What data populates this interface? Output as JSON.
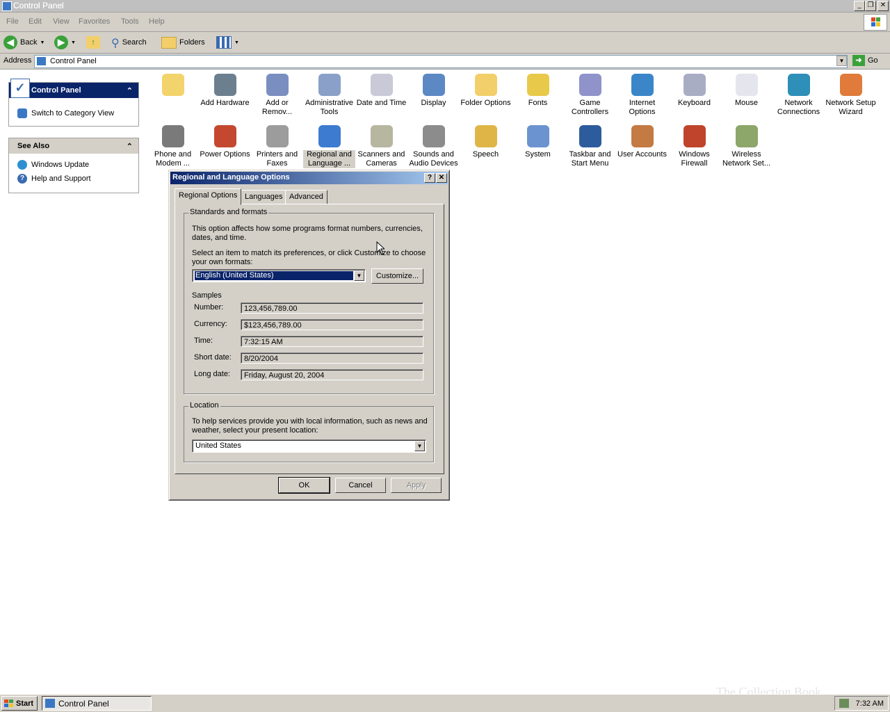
{
  "window": {
    "title": "Control Panel",
    "controls": [
      "_",
      "❐",
      "✕"
    ]
  },
  "menu": [
    "File",
    "Edit",
    "View",
    "Favorites",
    "Tools",
    "Help"
  ],
  "toolbar": {
    "back": "Back",
    "search": "Search",
    "folders": "Folders"
  },
  "address": {
    "label": "Address",
    "value": "Control Panel",
    "go": "Go"
  },
  "sidebar": {
    "control_panel": {
      "title": "Control Panel",
      "items": [
        "Switch to Category View"
      ]
    },
    "see_also": {
      "title": "See Also",
      "items": [
        "Windows Update",
        "Help and Support"
      ]
    }
  },
  "icons": [
    {
      "label": "",
      "color": "#f3d36b"
    },
    {
      "label": "Add Hardware",
      "color": "#6c7f8f"
    },
    {
      "label": "Add or Remov...",
      "color": "#7a8ec0"
    },
    {
      "label": "Administrative Tools",
      "color": "#8aa0c8"
    },
    {
      "label": "Date and Time",
      "color": "#c9c9d8"
    },
    {
      "label": "Display",
      "color": "#5c88c4"
    },
    {
      "label": "Folder Options",
      "color": "#f2cf6a"
    },
    {
      "label": "Fonts",
      "color": "#e9c94a"
    },
    {
      "label": "Game Controllers",
      "color": "#8f93c9"
    },
    {
      "label": "Internet Options",
      "color": "#3b86c9"
    },
    {
      "label": "Keyboard",
      "color": "#a9adc4"
    },
    {
      "label": "Mouse",
      "color": "#e5e5ee"
    },
    {
      "label": "Network Connections",
      "color": "#2e8fb8"
    },
    {
      "label": "Network Setup Wizard",
      "color": "#e07b3c"
    },
    {
      "label": "Phone and Modem ...",
      "color": "#7a7a7a"
    },
    {
      "label": "Power Options",
      "color": "#c4482f"
    },
    {
      "label": "Printers and Faxes",
      "color": "#9c9c9c"
    },
    {
      "label": "Regional and Language ...",
      "color": "#3c7bd0"
    },
    {
      "label": "Scanners and Cameras",
      "color": "#b7b7a0"
    },
    {
      "label": "Sounds and Audio Devices",
      "color": "#8c8c8c"
    },
    {
      "label": "Speech",
      "color": "#e0b548"
    },
    {
      "label": "System",
      "color": "#6b93cf"
    },
    {
      "label": "Taskbar and Start Menu",
      "color": "#2d5c9c"
    },
    {
      "label": "User Accounts",
      "color": "#c47a43"
    },
    {
      "label": "Windows Firewall",
      "color": "#c0432c"
    },
    {
      "label": "Wireless Network Set...",
      "color": "#8da66a"
    }
  ],
  "dialog": {
    "title": "Regional and Language Options",
    "tabs": [
      "Regional Options",
      "Languages",
      "Advanced"
    ],
    "standards": {
      "legend": "Standards and formats",
      "desc": "This option affects how some programs format numbers, currencies, dates, and time.",
      "select_prompt": "Select an item to match its preferences, or click Customize to choose your own formats:",
      "selected": "English (United States)",
      "customize": "Customize...",
      "samples_label": "Samples",
      "samples": [
        {
          "label": "Number:",
          "value": "123,456,789.00"
        },
        {
          "label": "Currency:",
          "value": "$123,456,789.00"
        },
        {
          "label": "Time:",
          "value": "7:32:15 AM"
        },
        {
          "label": "Short date:",
          "value": "8/20/2004"
        },
        {
          "label": "Long date:",
          "value": "Friday, August 20, 2004"
        }
      ]
    },
    "location": {
      "legend": "Location",
      "desc": "To help services provide you with local information, such as news and weather, select your present location:",
      "selected": "United States"
    },
    "buttons": {
      "ok": "OK",
      "cancel": "Cancel",
      "apply": "Apply"
    }
  },
  "taskbar": {
    "start": "Start",
    "task": "Control Panel",
    "clock": "7:32 AM"
  },
  "watermark": "The Collection Book"
}
